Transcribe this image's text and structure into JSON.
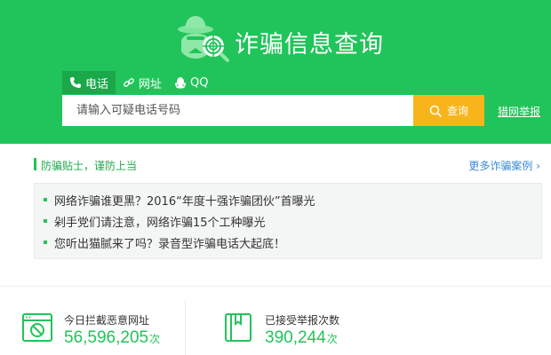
{
  "header": {
    "title": "诈骗信息查询",
    "logo_icon": "spy-magnifier-icon",
    "bg_color": "#21c45a"
  },
  "tabs": [
    {
      "label": "电话",
      "icon": "phone-icon",
      "active": true
    },
    {
      "label": "网址",
      "icon": "link-icon",
      "active": false
    },
    {
      "label": "QQ",
      "icon": "qq-penguin-icon",
      "active": false
    }
  ],
  "search": {
    "placeholder": "请输入可疑电话号码",
    "value": "",
    "button_label": "查询",
    "button_color": "#f8b51b"
  },
  "report_link": "猎网举报",
  "tips": {
    "title": "防骗贴士，谨防上当",
    "more_label": "更多诈骗案例",
    "more_icon": "chevron-right-icon",
    "items": [
      "网络诈骗谁更黑？2016“年度十强诈骗团伙”首曝光",
      "剁手党们请注意，网络诈骗15个工种曝光",
      "您听出猫腻来了吗？录音型诈骗电话大起底！"
    ]
  },
  "stats": [
    {
      "label": "今日拦截恶意网址",
      "value": "56,596,205",
      "unit": "次",
      "icon": "blocked-browser-icon"
    },
    {
      "label": "已接受举报次数",
      "value": "390,244",
      "unit": "次",
      "icon": "report-book-icon"
    }
  ]
}
